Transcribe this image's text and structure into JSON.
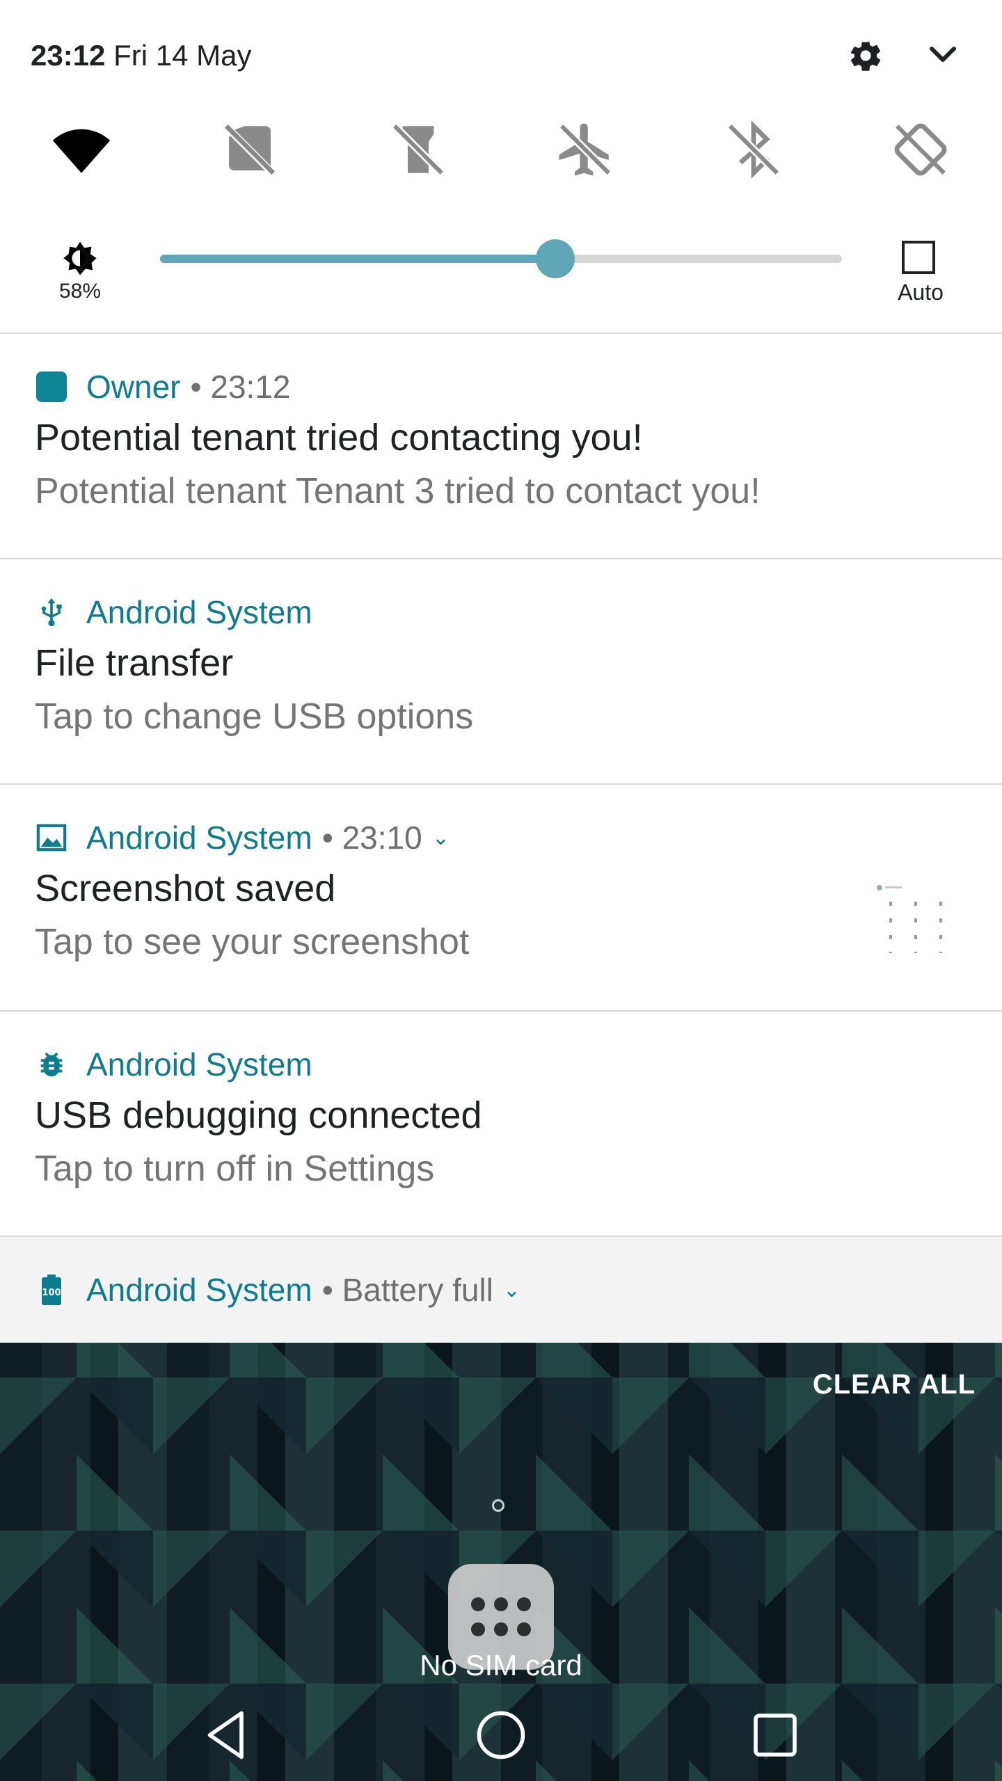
{
  "status": {
    "time": "23:12",
    "date": "Fri 14 May"
  },
  "quick_tiles": [
    {
      "icon": "wifi-icon"
    },
    {
      "icon": "sim-off-icon"
    },
    {
      "icon": "flashlight-off-icon"
    },
    {
      "icon": "airplane-mode-off-icon"
    },
    {
      "icon": "bluetooth-off-icon"
    },
    {
      "icon": "auto-rotate-off-icon"
    }
  ],
  "brightness": {
    "percent_label": "58%",
    "level": 0.58,
    "auto_label": "Auto"
  },
  "notifications": [
    {
      "app": "Owner",
      "meta": "• 23:12",
      "title": "Potential tenant tried contacting you!",
      "text": "Potential tenant Tenant 3 tried to contact you!",
      "icon": "app-square-icon"
    },
    {
      "app": "Android System",
      "meta": "",
      "title": "File transfer",
      "text": "Tap to change USB options",
      "icon": "usb-icon"
    },
    {
      "app": "Android System",
      "meta": "• 23:10",
      "title": "Screenshot saved",
      "text": "Tap to see your screenshot",
      "icon": "image-icon"
    },
    {
      "app": "Android System",
      "meta": "",
      "title": "USB debugging connected",
      "text": "Tap to turn off in Settings",
      "icon": "bug-icon"
    }
  ],
  "battery_notification": {
    "app": "Android System",
    "meta": "• Battery full",
    "icon": "battery-full-icon"
  },
  "home": {
    "clear_all": "CLEAR ALL",
    "no_sim": "No SIM card"
  },
  "colors": {
    "accent": "#0d7c8e",
    "slider": "#5fa6b6"
  }
}
